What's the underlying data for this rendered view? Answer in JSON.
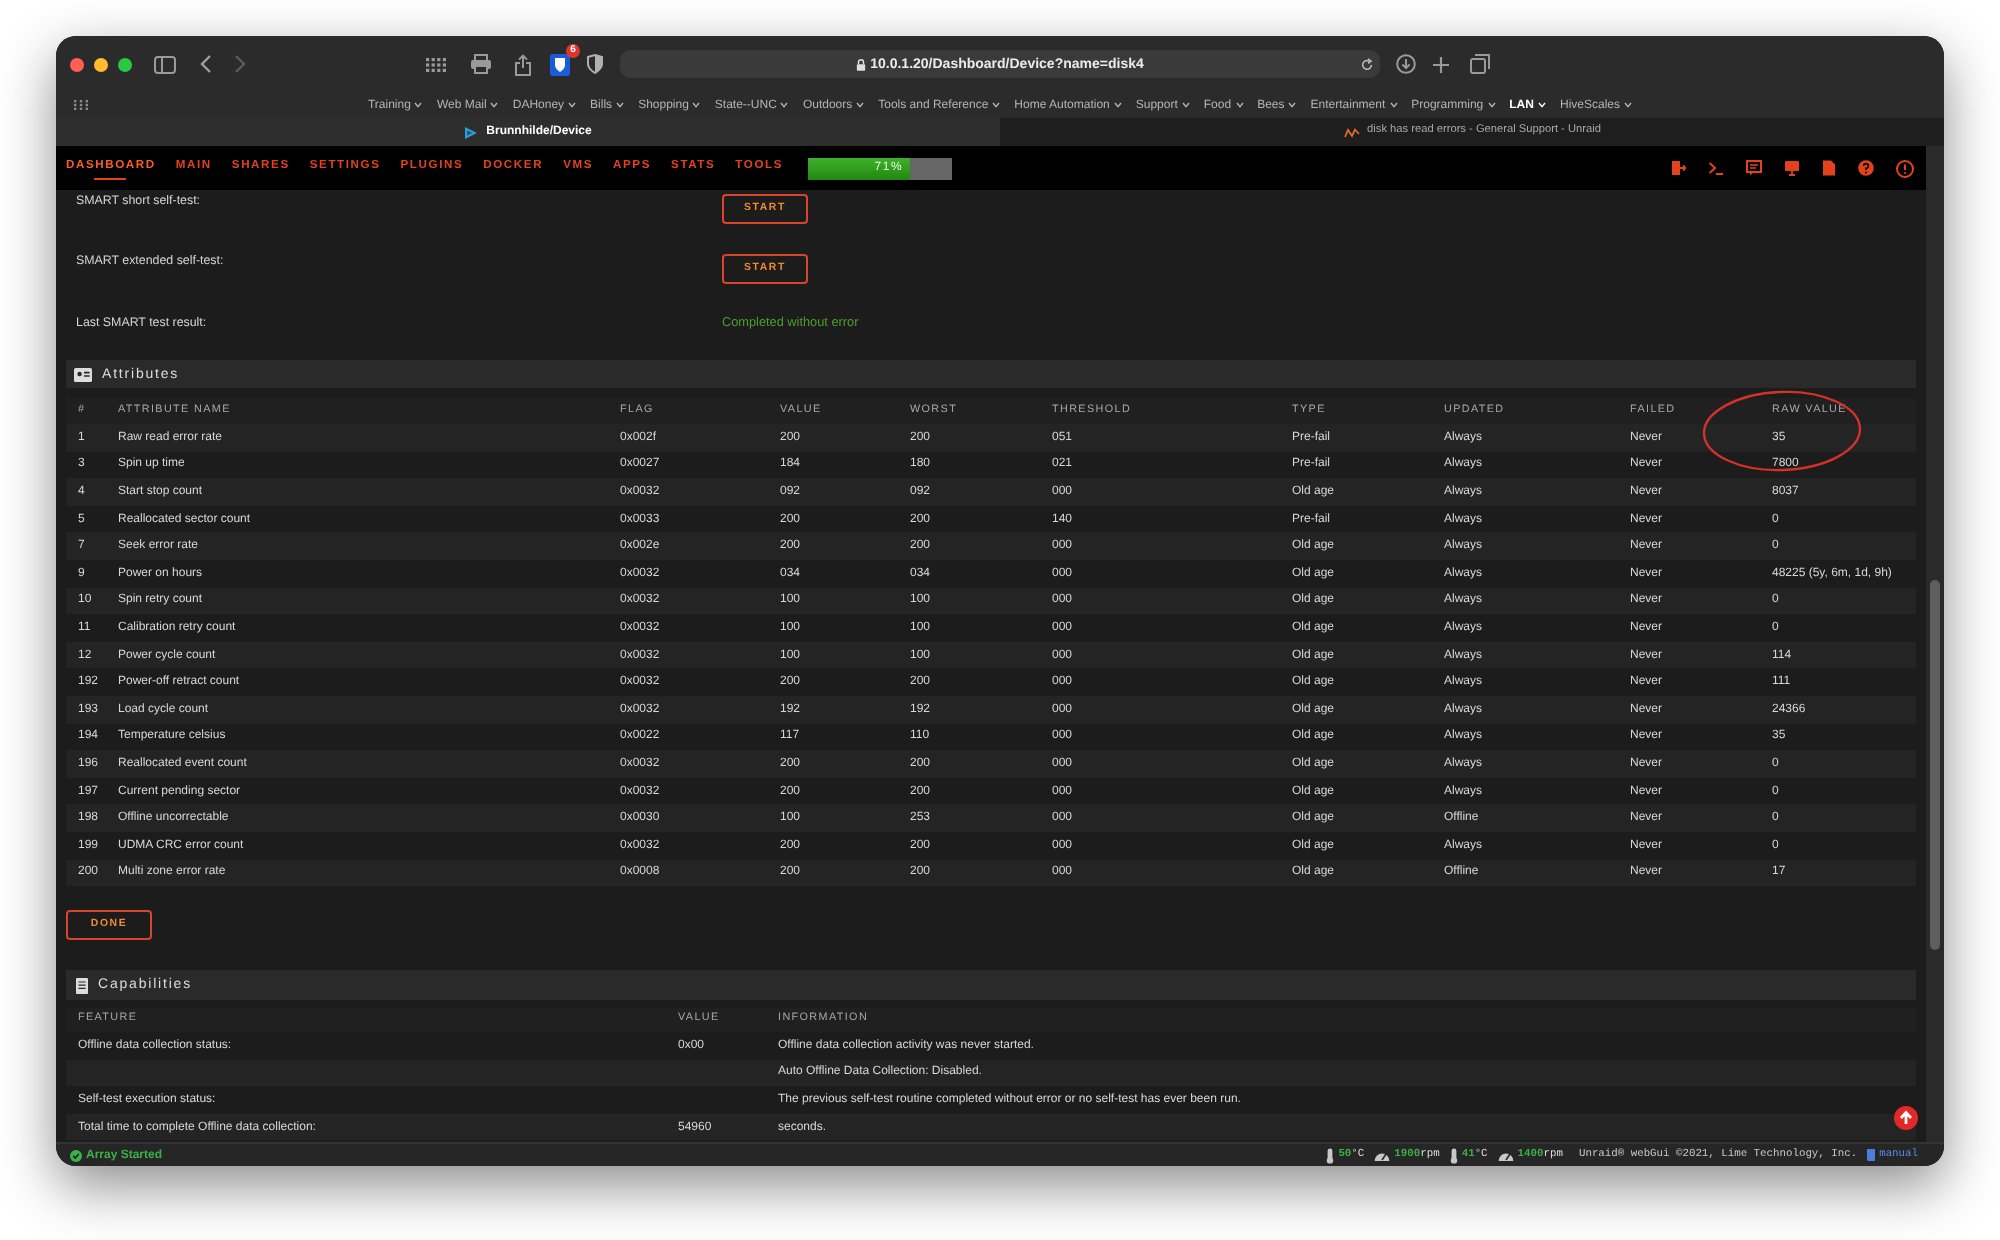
{
  "browser": {
    "url": "10.0.1.20/Dashboard/Device?name=disk4",
    "extension_badge": "6",
    "bookmarks": [
      {
        "label": "Training",
        "bold": false
      },
      {
        "label": "Web Mail",
        "bold": false
      },
      {
        "label": "DAHoney",
        "bold": false
      },
      {
        "label": "Bills",
        "bold": false
      },
      {
        "label": "Shopping",
        "bold": false
      },
      {
        "label": "State--UNC",
        "bold": false
      },
      {
        "label": "Outdoors",
        "bold": false
      },
      {
        "label": "Tools and Reference",
        "bold": false
      },
      {
        "label": "Home Automation",
        "bold": false
      },
      {
        "label": "Support",
        "bold": false
      },
      {
        "label": "Food",
        "bold": false
      },
      {
        "label": "Bees",
        "bold": false
      },
      {
        "label": "Entertainment",
        "bold": false
      },
      {
        "label": "Programming",
        "bold": false
      },
      {
        "label": "LAN",
        "bold": true
      },
      {
        "label": "HiveScales",
        "bold": false
      }
    ],
    "tabs": [
      {
        "title": "Brunnhilde/Device",
        "selected": true
      },
      {
        "title": "disk has read errors - General Support - Unraid",
        "selected": false
      }
    ]
  },
  "nav": {
    "items": [
      {
        "label": "DASHBOARD",
        "selected": true
      },
      {
        "label": "MAIN",
        "selected": false
      },
      {
        "label": "SHARES",
        "selected": false
      },
      {
        "label": "SETTINGS",
        "selected": false
      },
      {
        "label": "PLUGINS",
        "selected": false
      },
      {
        "label": "DOCKER",
        "selected": false
      },
      {
        "label": "VMS",
        "selected": false
      },
      {
        "label": "APPS",
        "selected": false
      },
      {
        "label": "STATS",
        "selected": false
      },
      {
        "label": "TOOLS",
        "selected": false
      }
    ],
    "utilization": {
      "level": 0.71,
      "reading": "71%"
    }
  },
  "self_test": [
    {
      "kind": "button",
      "label": "SMART short self-test:",
      "button": "START"
    },
    {
      "kind": "button",
      "label": "SMART extended self-test:",
      "button": "START"
    },
    {
      "kind": "result",
      "label": "Last SMART test result:",
      "result": "Completed without error"
    }
  ],
  "attributes": {
    "title": "Attributes",
    "columns": [
      "#",
      "ATTRIBUTE NAME",
      "FLAG",
      "VALUE",
      "WORST",
      "THRESHOLD",
      "TYPE",
      "UPDATED",
      "FAILED",
      "RAW VALUE"
    ],
    "rows": [
      [
        "1",
        "Raw read error rate",
        "0x002f",
        "200",
        "200",
        "051",
        "Pre-fail",
        "Always",
        "Never",
        "35"
      ],
      [
        "3",
        "Spin up time",
        "0x0027",
        "184",
        "180",
        "021",
        "Pre-fail",
        "Always",
        "Never",
        "7800"
      ],
      [
        "4",
        "Start stop count",
        "0x0032",
        "092",
        "092",
        "000",
        "Old age",
        "Always",
        "Never",
        "8037"
      ],
      [
        "5",
        "Reallocated sector count",
        "0x0033",
        "200",
        "200",
        "140",
        "Pre-fail",
        "Always",
        "Never",
        "0"
      ],
      [
        "7",
        "Seek error rate",
        "0x002e",
        "200",
        "200",
        "000",
        "Old age",
        "Always",
        "Never",
        "0"
      ],
      [
        "9",
        "Power on hours",
        "0x0032",
        "034",
        "034",
        "000",
        "Old age",
        "Always",
        "Never",
        "48225 (5y, 6m, 1d, 9h)"
      ],
      [
        "10",
        "Spin retry count",
        "0x0032",
        "100",
        "100",
        "000",
        "Old age",
        "Always",
        "Never",
        "0"
      ],
      [
        "11",
        "Calibration retry count",
        "0x0032",
        "100",
        "100",
        "000",
        "Old age",
        "Always",
        "Never",
        "0"
      ],
      [
        "12",
        "Power cycle count",
        "0x0032",
        "100",
        "100",
        "000",
        "Old age",
        "Always",
        "Never",
        "114"
      ],
      [
        "192",
        "Power-off retract count",
        "0x0032",
        "200",
        "200",
        "000",
        "Old age",
        "Always",
        "Never",
        "111"
      ],
      [
        "193",
        "Load cycle count",
        "0x0032",
        "192",
        "192",
        "000",
        "Old age",
        "Always",
        "Never",
        "24366"
      ],
      [
        "194",
        "Temperature celsius",
        "0x0022",
        "117",
        "110",
        "000",
        "Old age",
        "Always",
        "Never",
        "35"
      ],
      [
        "196",
        "Reallocated event count",
        "0x0032",
        "200",
        "200",
        "000",
        "Old age",
        "Always",
        "Never",
        "0"
      ],
      [
        "197",
        "Current pending sector",
        "0x0032",
        "200",
        "200",
        "000",
        "Old age",
        "Always",
        "Never",
        "0"
      ],
      [
        "198",
        "Offline uncorrectable",
        "0x0030",
        "100",
        "253",
        "000",
        "Old age",
        "Offline",
        "Never",
        "0"
      ],
      [
        "199",
        "UDMA CRC error count",
        "0x0032",
        "200",
        "200",
        "000",
        "Old age",
        "Always",
        "Never",
        "0"
      ],
      [
        "200",
        "Multi zone error rate",
        "0x0008",
        "200",
        "200",
        "000",
        "Old age",
        "Offline",
        "Never",
        "17"
      ]
    ]
  },
  "done_button": "DONE",
  "capabilities": {
    "title": "Capabilities",
    "columns": [
      "FEATURE",
      "VALUE",
      "INFORMATION"
    ],
    "rows": [
      {
        "feature": "Offline data collection status:",
        "value": "0x00",
        "information": "Offline data collection activity was never started."
      },
      {
        "information": "Auto Offline Data Collection: Disabled."
      },
      {
        "feature": "Self-test execution status:",
        "information": "The previous self-test routine completed without error or no self-test has ever been run."
      },
      {
        "feature": "Total time to complete Offline data collection:",
        "value": "54960",
        "information": "seconds."
      }
    ]
  },
  "status_bar": {
    "array_status": "Array Started",
    "sensors": [
      {
        "kind": "temperature",
        "value": "50",
        "unit": "°C"
      },
      {
        "kind": "fan",
        "value": "1900",
        "unit": "rpm"
      },
      {
        "kind": "temperature",
        "value": "41",
        "unit": "°C"
      },
      {
        "kind": "fan",
        "value": "1400",
        "unit": "rpm"
      }
    ],
    "copyright": "Unraid® webGui ©2021, Lime Technology, Inc.",
    "manual": "manual"
  }
}
